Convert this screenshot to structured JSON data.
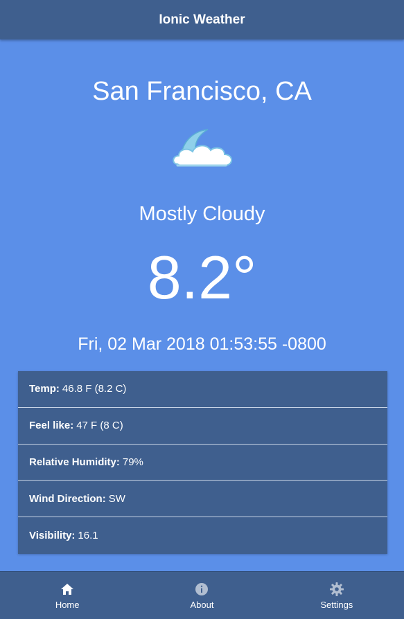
{
  "header": {
    "title": "Ionic Weather"
  },
  "weather": {
    "location": "San Francisco, CA",
    "icon": "mostly-cloudy-icon",
    "condition": "Mostly Cloudy",
    "temperature": "8.2°",
    "observed_at": "Fri, 02 Mar 2018 01:53:55 -0800"
  },
  "details": [
    {
      "label": "Temp:",
      "value": "46.8 F (8.2 C)"
    },
    {
      "label": "Feel like:",
      "value": "47 F (8 C)"
    },
    {
      "label": "Relative Humidity:",
      "value": "79%"
    },
    {
      "label": "Wind Direction:",
      "value": "SW"
    },
    {
      "label": "Visibility:",
      "value": "16.1"
    }
  ],
  "tabs": [
    {
      "label": "Home",
      "icon": "home-icon",
      "active": true
    },
    {
      "label": "About",
      "icon": "info-icon",
      "active": false
    },
    {
      "label": "Settings",
      "icon": "gear-icon",
      "active": false
    }
  ],
  "colors": {
    "background": "#5b8fe8",
    "toolbar": "#3f5f8e"
  }
}
